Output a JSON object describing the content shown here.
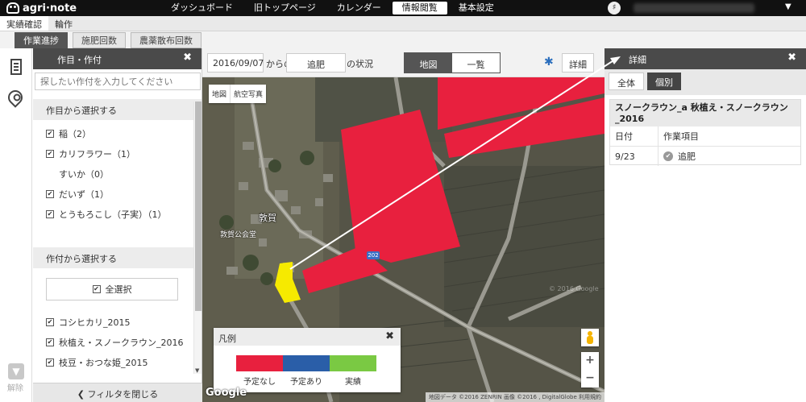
{
  "app": {
    "logo": "agri·note",
    "user_icon": "♯"
  },
  "topnav": [
    {
      "label": "ダッシュボード",
      "active": false
    },
    {
      "label": "旧トップページ",
      "active": false
    },
    {
      "label": "カレンダー",
      "active": false
    },
    {
      "label": "情報閲覧",
      "active": true
    },
    {
      "label": "基本設定",
      "active": false
    }
  ],
  "subnav": [
    {
      "label": "実績確認",
      "active": true
    },
    {
      "label": "輪作",
      "active": false
    }
  ],
  "filters": [
    {
      "label": "作業進捗",
      "active": true
    },
    {
      "label": "施肥回数",
      "active": false
    },
    {
      "label": "農薬散布回数",
      "active": false
    }
  ],
  "rail": {
    "filter_label": "解除"
  },
  "filter_panel": {
    "title": "作目・作付",
    "search_placeholder": "探したい作付を入力してください",
    "section1_title": "作目から選択する",
    "crops": [
      {
        "label": "稲（2）",
        "checked": true
      },
      {
        "label": "カリフラワー（1）",
        "checked": true
      },
      {
        "label": "すいか（0）",
        "checked": false
      },
      {
        "label": "だいず（1）",
        "checked": true
      },
      {
        "label": "とうもろこし（子実）（1）",
        "checked": true
      }
    ],
    "section2_title": "作付から選択する",
    "select_all": "全選択",
    "plantings": [
      {
        "label": "コシヒカリ_2015",
        "checked": true
      },
      {
        "label": "秋植え・スノークラウン_2016",
        "checked": true
      },
      {
        "label": "枝豆・おつな姫_2015",
        "checked": true
      }
    ],
    "close_filter": "フィルタを閉じる"
  },
  "map_bar": {
    "date": "2016/09/07",
    "from_text": "からの",
    "work": "追肥",
    "status_text": "の状況",
    "view_map": "地図",
    "view_list": "一覧",
    "detail_button": "詳細"
  },
  "map": {
    "type_map": "地図",
    "type_aerial": "航空写真",
    "place_name": "敦賀",
    "poi": "敦賀公会堂",
    "road_number": "202",
    "google": "Google",
    "attribution": "地図データ ©2016 ZENRIN 画像 ©2016 , DigitalGlobe  利用規約",
    "watermark": "© 2016 Google"
  },
  "legend": {
    "title": "凡例",
    "items": [
      {
        "label": "予定なし",
        "color": "#e8203e"
      },
      {
        "label": "予定あり",
        "color": "#2a5ea8"
      },
      {
        "label": "実績",
        "color": "#7ac943"
      }
    ]
  },
  "detail_panel": {
    "title": "詳細",
    "tab_all": "全体",
    "tab_individual": "個別",
    "record_title": "スノークラウン_a 秋植え・スノークラウン_2016",
    "col_date": "日付",
    "col_work": "作業項目",
    "rows": [
      {
        "date": "9/23",
        "work": "追肥"
      }
    ]
  },
  "colors": {
    "field_unplanned": "#e8203e",
    "field_selected": "#f6ea00",
    "header_bg": "#111111",
    "panel_head": "#4a4a4a"
  }
}
